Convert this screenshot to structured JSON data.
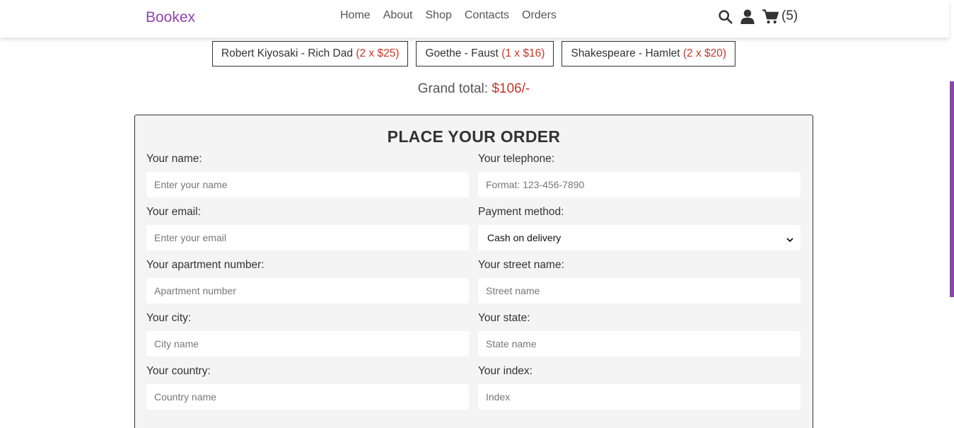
{
  "brand": {
    "name": "Bookex",
    "accent": "#8e44ad",
    "price_color": "#c0392b"
  },
  "nav": {
    "home": "Home",
    "about": "About",
    "shop": "Shop",
    "contacts": "Contacts",
    "orders": "Orders"
  },
  "header_icons": {
    "search": "search-icon",
    "user": "user-icon",
    "cart": "cart-icon",
    "cart_count": "(5)"
  },
  "order_items": [
    {
      "title": "Robert Kiyosaki - Rich Dad",
      "qty": "(2 x $25)"
    },
    {
      "title": "Goethe - Faust",
      "qty": "(1 x $16)"
    },
    {
      "title": "Shakespeare - Hamlet",
      "qty": "(2 x $20)"
    }
  ],
  "grand_total": {
    "label": "Grand total:",
    "amount": "$106/-"
  },
  "form": {
    "title": "PLACE YOUR ORDER",
    "name": {
      "label": "Your name:",
      "placeholder": "Enter your name"
    },
    "telephone": {
      "label": "Your telephone:",
      "placeholder": "Format: 123-456-7890"
    },
    "email": {
      "label": "Your email:",
      "placeholder": "Enter your email"
    },
    "payment": {
      "label": "Payment method:",
      "selected": "Cash on delivery"
    },
    "apartment": {
      "label": "Your apartment number:",
      "placeholder": "Apartment number"
    },
    "street": {
      "label": "Your street name:",
      "placeholder": "Street name"
    },
    "city": {
      "label": "Your city:",
      "placeholder": "City name"
    },
    "state": {
      "label": "Your state:",
      "placeholder": "State name"
    },
    "country": {
      "label": "Your country:",
      "placeholder": "Country name"
    },
    "index": {
      "label": "Your index:",
      "placeholder": "Index"
    }
  }
}
